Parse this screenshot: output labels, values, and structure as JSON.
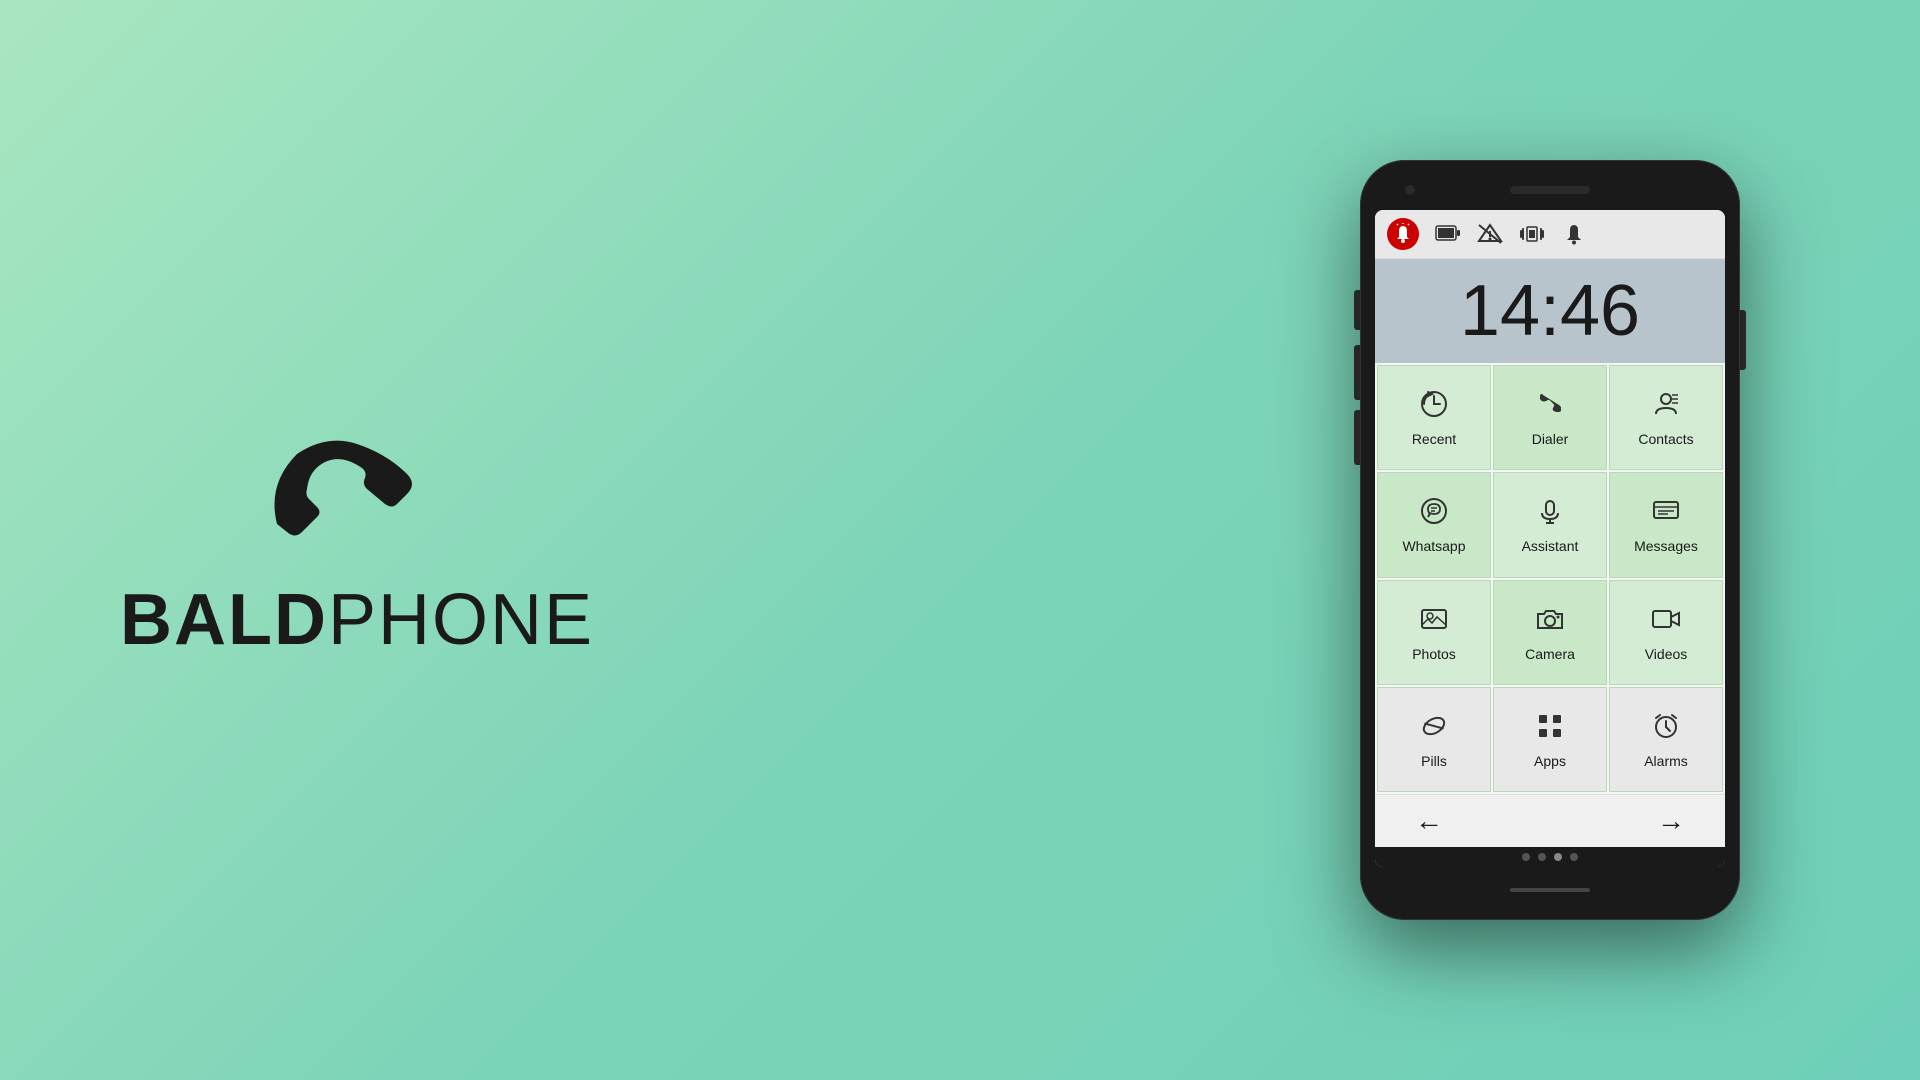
{
  "logo": {
    "bold": "BALD",
    "light": "PHONE"
  },
  "phone": {
    "time": "14:46",
    "status_icons": [
      "sos",
      "battery",
      "no-signal",
      "vibrate",
      "bell"
    ],
    "page_dots": [
      false,
      false,
      true,
      false
    ],
    "apps": [
      {
        "id": "recent",
        "label": "Recent",
        "icon": "🕐",
        "color": "green"
      },
      {
        "id": "dialer",
        "label": "Dialer",
        "icon": "📞",
        "color": "green"
      },
      {
        "id": "contacts",
        "label": "Contacts",
        "icon": "👤",
        "color": "green"
      },
      {
        "id": "whatsapp",
        "label": "Whatsapp",
        "icon": "💬",
        "color": "green"
      },
      {
        "id": "assistant",
        "label": "Assistant",
        "icon": "🎤",
        "color": "green"
      },
      {
        "id": "messages",
        "label": "Messages",
        "icon": "💬",
        "color": "green"
      },
      {
        "id": "photos",
        "label": "Photos",
        "icon": "🖼",
        "color": "green"
      },
      {
        "id": "camera",
        "label": "Camera",
        "icon": "📷",
        "color": "green"
      },
      {
        "id": "videos",
        "label": "Videos",
        "icon": "🎬",
        "color": "green"
      },
      {
        "id": "pills",
        "label": "Pills",
        "icon": "💊",
        "color": "light"
      },
      {
        "id": "apps",
        "label": "Apps",
        "icon": "⊞",
        "color": "light"
      },
      {
        "id": "alarms",
        "label": "Alarms",
        "icon": "⏰",
        "color": "light"
      }
    ],
    "nav": {
      "back": "←",
      "forward": "→"
    }
  }
}
